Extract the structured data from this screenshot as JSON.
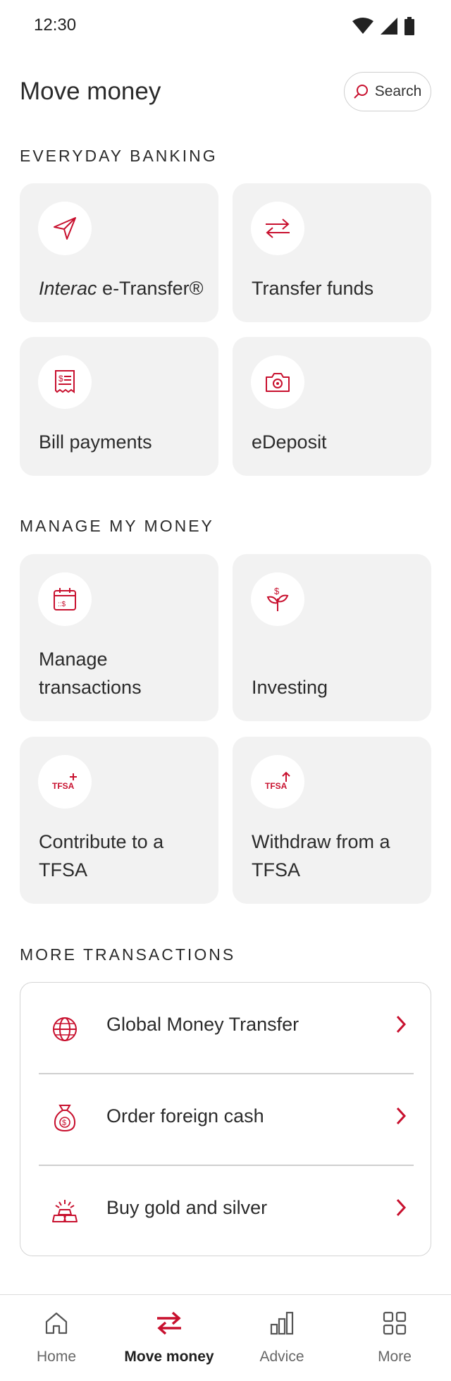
{
  "status_bar": {
    "time": "12:30"
  },
  "header": {
    "title": "Move money",
    "search_label": "Search"
  },
  "sections": {
    "everyday": "EVERYDAY BANKING",
    "manage": "MANAGE MY MONEY",
    "more": "MORE TRANSACTIONS"
  },
  "everyday_tiles": [
    {
      "label_italic": "Interac",
      "label": " e-Transfer®",
      "icon": "paper-plane-icon"
    },
    {
      "label": "Transfer funds",
      "icon": "transfer-arrows-icon"
    },
    {
      "label": "Bill payments",
      "icon": "bill-icon"
    },
    {
      "label": "eDeposit",
      "icon": "camera-icon"
    }
  ],
  "manage_tiles": [
    {
      "label": "Manage transactions",
      "icon": "calendar-icon"
    },
    {
      "label": "Investing",
      "icon": "plant-dollar-icon"
    },
    {
      "label": "Contribute to a TFSA",
      "icon": "tfsa-plus-icon",
      "badge": "TFSA"
    },
    {
      "label": "Withdraw from a TFSA",
      "icon": "tfsa-arrow-icon",
      "badge": "TFSA"
    }
  ],
  "more_transactions": [
    {
      "label": "Global Money Transfer",
      "icon": "globe-icon"
    },
    {
      "label": "Order foreign cash",
      "icon": "money-bag-icon"
    },
    {
      "label": "Buy gold and silver",
      "icon": "gold-bars-icon"
    }
  ],
  "bottom_nav": [
    {
      "label": "Home",
      "icon": "home-icon"
    },
    {
      "label": "Move money",
      "icon": "transfer-icon",
      "active": true
    },
    {
      "label": "Advice",
      "icon": "bar-chart-icon"
    },
    {
      "label": "More",
      "icon": "grid-icon"
    }
  ],
  "colors": {
    "accent": "#c8102e",
    "tile_bg": "#f2f2f2",
    "text": "#2b2b2b"
  }
}
